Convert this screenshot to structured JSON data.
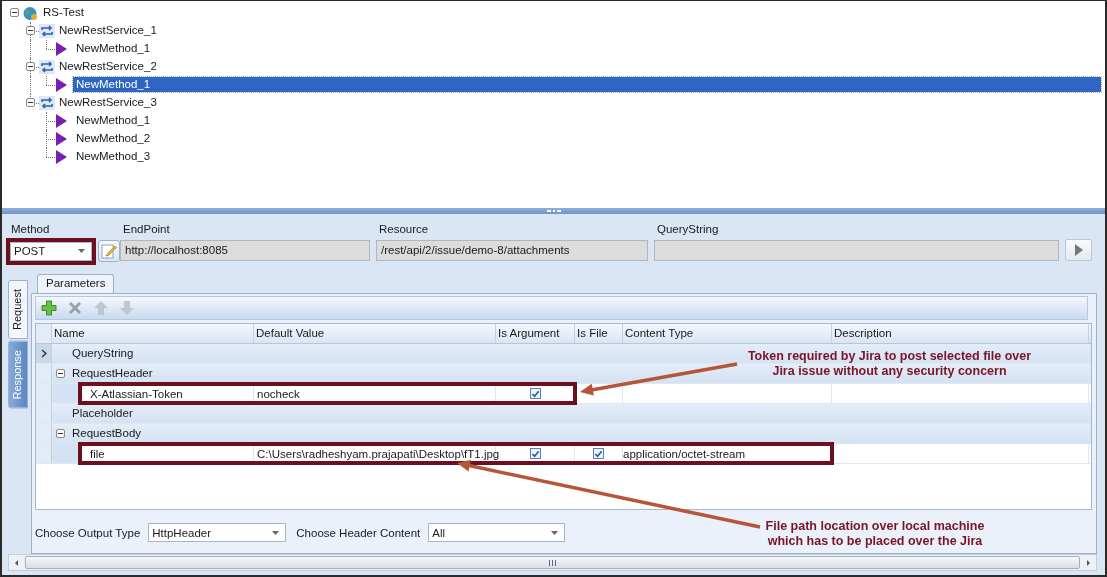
{
  "tree": {
    "label": "RS-Test",
    "kind": "root",
    "expanded": true,
    "selected": false,
    "children": [
      {
        "label": "NewRestService_1",
        "kind": "service",
        "expanded": true,
        "selected": false,
        "children": [
          {
            "label": "NewMethod_1",
            "kind": "method",
            "selected": false
          }
        ]
      },
      {
        "label": "NewRestService_2",
        "kind": "service",
        "expanded": true,
        "selected": false,
        "children": [
          {
            "label": "NewMethod_1",
            "kind": "method",
            "selected": true
          }
        ]
      },
      {
        "label": "NewRestService_3",
        "kind": "service",
        "expanded": true,
        "selected": false,
        "children": [
          {
            "label": "NewMethod_1",
            "kind": "method",
            "selected": false
          },
          {
            "label": "NewMethod_2",
            "kind": "method",
            "selected": false
          },
          {
            "label": "NewMethod_3",
            "kind": "method",
            "selected": false
          }
        ]
      }
    ]
  },
  "request": {
    "method": {
      "label": "Method",
      "value": "POST",
      "outlined": true
    },
    "endpoint": {
      "label": "EndPoint",
      "value": "http://localhost:8085"
    },
    "resource": {
      "label": "Resource",
      "value": "/rest/api/2/issue/demo-8/attachments"
    },
    "querystring": {
      "label": "QueryString"
    }
  },
  "side_tabs": [
    {
      "label": "Request",
      "selected": true
    },
    {
      "label": "Response",
      "selected": false
    }
  ],
  "tabs": [
    {
      "label": "Parameters",
      "selected": true
    }
  ],
  "toolbar": [
    {
      "kind": "add",
      "disabled": false
    },
    {
      "kind": "delete",
      "disabled": true
    },
    {
      "kind": "move-up",
      "disabled": true
    },
    {
      "kind": "move-down",
      "disabled": true
    }
  ],
  "table": {
    "columns": [
      "Name",
      "Default Value",
      "Is Argument",
      "Is File",
      "Content Type",
      "Description"
    ],
    "rows": [
      {
        "kind": "group",
        "name": "QueryString",
        "current": true
      },
      {
        "kind": "group",
        "name": "RequestHeader",
        "expanded": true,
        "current": false
      },
      {
        "kind": "param",
        "name": "X-Atlassian-Token",
        "default_value": "nocheck",
        "is_argument": true,
        "outlined": true,
        "current": false
      },
      {
        "kind": "group",
        "name": "Placeholder",
        "current": false
      },
      {
        "kind": "group",
        "name": "RequestBody",
        "expanded": true,
        "current": false
      },
      {
        "kind": "param",
        "name": "file",
        "default_value": "C:\\Users\\radheshyam.prajapati\\Desktop\\fT1.jpg",
        "is_argument": true,
        "is_file": true,
        "content_type": "application/octet-stream",
        "outlined": true,
        "current": false
      }
    ]
  },
  "output_options": [
    {
      "label": "Choose Output Type",
      "value": "HttpHeader"
    },
    {
      "label": "Choose Header Content",
      "value": "All"
    }
  ],
  "annotations": [
    {
      "lines": [
        "Token required by Jira to post selected file over",
        "Jira issue without any security concern"
      ]
    },
    {
      "lines": [
        "File path location over local machine",
        "which has to be placed over the Jira"
      ]
    }
  ]
}
